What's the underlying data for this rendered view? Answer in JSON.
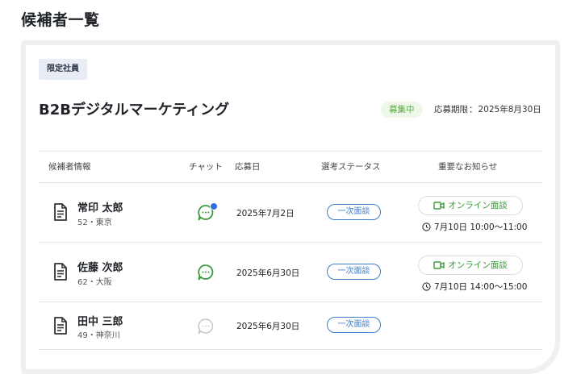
{
  "page": {
    "title": "候補者一覧"
  },
  "job": {
    "tag": "限定社員",
    "title": "B2Bデジタルマーケティング",
    "status_badge": "募集中",
    "deadline_label": "応募期限",
    "deadline_sep": "：",
    "deadline_value": "2025年8月30日"
  },
  "table": {
    "headers": {
      "candidate": "候補者情報",
      "chat": "チャット",
      "applied": "応募日",
      "status": "選考ステータス",
      "notice": "重要なお知らせ"
    },
    "rows": [
      {
        "name": "常印 太郎",
        "meta": "52・東京",
        "chat_state": "active-unread",
        "applied": "2025年7月2日",
        "status": "一次面談",
        "notice_button": "オンライン面談",
        "notice_time": "7月10日 10:00〜11:00"
      },
      {
        "name": "佐藤 次郎",
        "meta": "62・大阪",
        "chat_state": "active",
        "applied": "2025年6月30日",
        "status": "一次面談",
        "notice_button": "オンライン面談",
        "notice_time": "7月10日 14:00〜15:00"
      },
      {
        "name": "田中 三郎",
        "meta": "49・神奈川",
        "chat_state": "inactive",
        "applied": "2025年6月30日",
        "status": "一次面談"
      }
    ]
  },
  "colors": {
    "chat_active": "#3a9a3a",
    "chat_inactive": "#c4c8cd",
    "unread_dot": "#2f6fe0",
    "status_outline": "#3d7fc9",
    "recruiting_green": "#59a83d"
  },
  "icons": {
    "document": "document-icon",
    "chat": "chat-bubble-icon",
    "video": "video-camera-icon",
    "clock": "clock-icon"
  }
}
